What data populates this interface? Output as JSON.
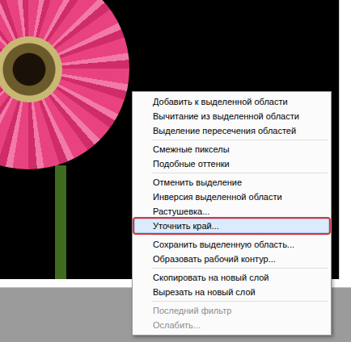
{
  "context_menu": {
    "items": [
      {
        "kind": "item",
        "label": "Добавить к выделенной области",
        "selected": false,
        "disabled": false
      },
      {
        "kind": "item",
        "label": "Вычитание из выделенной области",
        "selected": false,
        "disabled": false
      },
      {
        "kind": "item",
        "label": "Выделение пересечения областей",
        "selected": false,
        "disabled": false
      },
      {
        "kind": "separator"
      },
      {
        "kind": "item",
        "label": "Смежные пикселы",
        "selected": false,
        "disabled": false
      },
      {
        "kind": "item",
        "label": "Подобные оттенки",
        "selected": false,
        "disabled": false
      },
      {
        "kind": "separator"
      },
      {
        "kind": "item",
        "label": "Отменить выделение",
        "selected": false,
        "disabled": false
      },
      {
        "kind": "item",
        "label": "Инверсия выделенной области",
        "selected": false,
        "disabled": false
      },
      {
        "kind": "item",
        "label": "Растушевка...",
        "selected": false,
        "disabled": false
      },
      {
        "kind": "item",
        "label": "Уточнить край...",
        "selected": true,
        "disabled": false
      },
      {
        "kind": "separator"
      },
      {
        "kind": "item",
        "label": "Сохранить выделенную область...",
        "selected": false,
        "disabled": false
      },
      {
        "kind": "item",
        "label": "Образовать рабочий контур...",
        "selected": false,
        "disabled": false
      },
      {
        "kind": "separator"
      },
      {
        "kind": "item",
        "label": "Скопировать на новый слой",
        "selected": false,
        "disabled": false
      },
      {
        "kind": "item",
        "label": "Вырезать на новый слой",
        "selected": false,
        "disabled": false
      },
      {
        "kind": "separator"
      },
      {
        "kind": "item",
        "label": "Последний фильтр",
        "selected": false,
        "disabled": true
      },
      {
        "kind": "item",
        "label": "Ослабить...",
        "selected": false,
        "disabled": true
      }
    ]
  }
}
